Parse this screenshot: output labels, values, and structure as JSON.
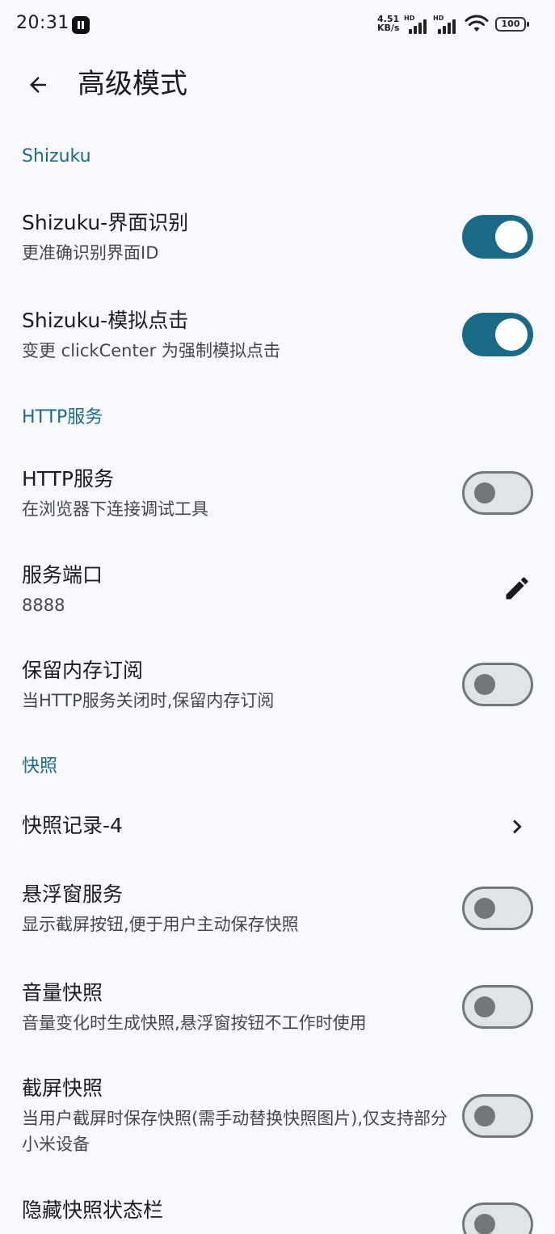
{
  "status_bar": {
    "time": "20:31",
    "net_speed_value": "4.51",
    "net_speed_unit": "KB/s",
    "signal_label": "HD",
    "battery": "100"
  },
  "app_bar": {
    "back_icon": "arrow-back-icon",
    "title": "高级模式"
  },
  "sections": {
    "shizuku": {
      "header": "Shizuku",
      "items": [
        {
          "title": "Shizuku-界面识别",
          "subtitle": "更准确识别界面ID",
          "toggle": "on"
        },
        {
          "title": "Shizuku-模拟点击",
          "subtitle": "变更 clickCenter 为强制模拟点击",
          "toggle": "on"
        }
      ]
    },
    "http": {
      "header": "HTTP服务",
      "items": [
        {
          "title": "HTTP服务",
          "subtitle": "在浏览器下连接调试工具",
          "toggle": "off"
        },
        {
          "title": "服务端口",
          "subtitle": "8888",
          "action_icon": "edit-pencil-icon"
        },
        {
          "title": "保留内存订阅",
          "subtitle": "当HTTP服务关闭时,保留内存订阅",
          "toggle": "off"
        }
      ]
    },
    "snapshot": {
      "header": "快照",
      "items": [
        {
          "title": "快照记录-4",
          "action_icon": "chevron-right-icon"
        },
        {
          "title": "悬浮窗服务",
          "subtitle": "显示截屏按钮,便于用户主动保存快照",
          "toggle": "off"
        },
        {
          "title": "音量快照",
          "subtitle": "音量变化时生成快照,悬浮窗按钮不工作时使用",
          "toggle": "off"
        },
        {
          "title": "截屏快照",
          "subtitle": "当用户截屏时保存快照(需手动替换快照图片),仅支持部分小米设备",
          "toggle": "off"
        },
        {
          "title": "隐藏快照状态栏",
          "subtitle": "",
          "toggle": "off"
        }
      ]
    }
  },
  "colors": {
    "background": "#f7f9fd",
    "accent": "#1a6986",
    "section_header": "#1d6b86",
    "switch_off_track": "#e0e3e7",
    "switch_off_outline": "#72777c"
  }
}
